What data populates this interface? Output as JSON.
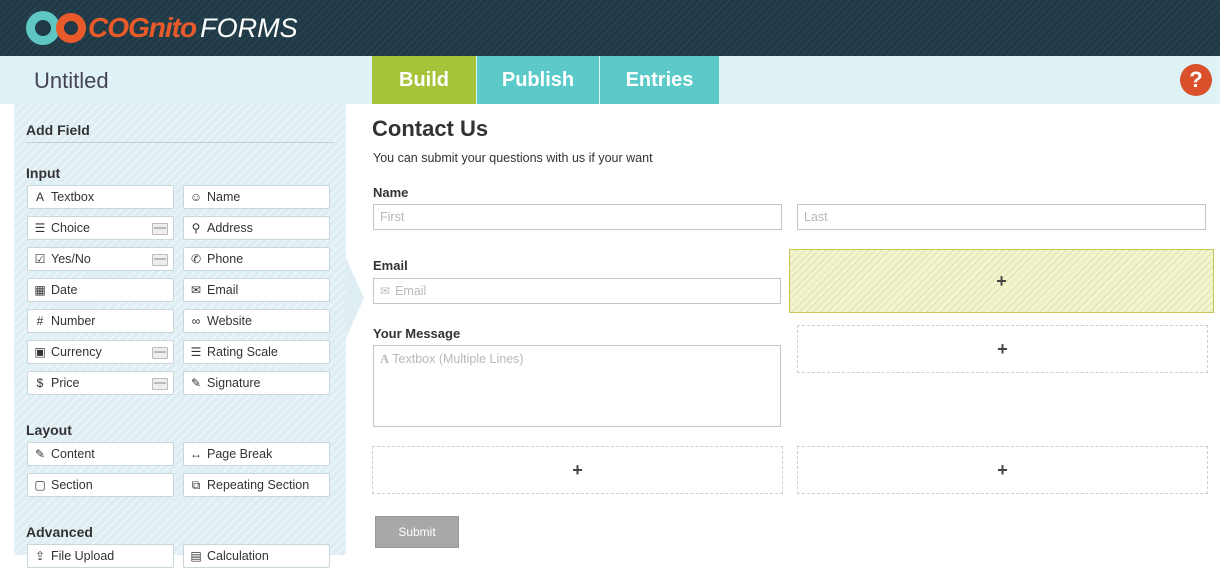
{
  "brand": {
    "logo_text": "COGnito",
    "logo_suffix": "FORMS"
  },
  "header": {
    "title": "Untitled",
    "tabs": [
      {
        "label": "Build"
      },
      {
        "label": "Publish"
      },
      {
        "label": "Entries"
      }
    ],
    "help_label": "?"
  },
  "sidebar": {
    "title": "Add Field",
    "sections": [
      {
        "label": "Input"
      },
      {
        "label": "Layout"
      },
      {
        "label": "Advanced"
      }
    ],
    "input_fields": [
      {
        "label": "Textbox",
        "icon": "A"
      },
      {
        "label": "Name",
        "icon": "☺"
      },
      {
        "label": "Choice",
        "icon": "☰"
      },
      {
        "label": "Address",
        "icon": "⚲"
      },
      {
        "label": "Yes/No",
        "icon": "☑"
      },
      {
        "label": "Phone",
        "icon": "✆"
      },
      {
        "label": "Date",
        "icon": "▦"
      },
      {
        "label": "Email",
        "icon": "✉"
      },
      {
        "label": "Number",
        "icon": "#"
      },
      {
        "label": "Website",
        "icon": "∞"
      },
      {
        "label": "Currency",
        "icon": "▣"
      },
      {
        "label": "Rating Scale",
        "icon": "☰"
      },
      {
        "label": "Price",
        "icon": "$"
      },
      {
        "label": "Signature",
        "icon": "✎"
      }
    ],
    "layout_fields": [
      {
        "label": "Content",
        "icon": "✎"
      },
      {
        "label": "Page Break",
        "icon": "↔"
      },
      {
        "label": "Section",
        "icon": "▢"
      },
      {
        "label": "Repeating Section",
        "icon": "⧉"
      }
    ],
    "advanced_fields": [
      {
        "label": "File Upload",
        "icon": "⇪"
      },
      {
        "label": "Calculation",
        "icon": "▤"
      }
    ]
  },
  "form": {
    "title": "Contact Us",
    "description": "You can submit your questions with us if your want",
    "name_label": "Name",
    "first_placeholder": "First",
    "last_placeholder": "Last",
    "email_label": "Email",
    "email_placeholder": "Email",
    "message_label": "Your Message",
    "message_placeholder": "Textbox (Multiple Lines)",
    "add_symbol": "+",
    "submit_label": "Submit"
  },
  "colors": {
    "topbar": "#1f3a46",
    "build_tab": "#a6c43a",
    "tab": "#5bcac8",
    "help": "#d9502a",
    "logo_accent": "#e85a2a",
    "logo_teal": "#5fc7c3"
  }
}
